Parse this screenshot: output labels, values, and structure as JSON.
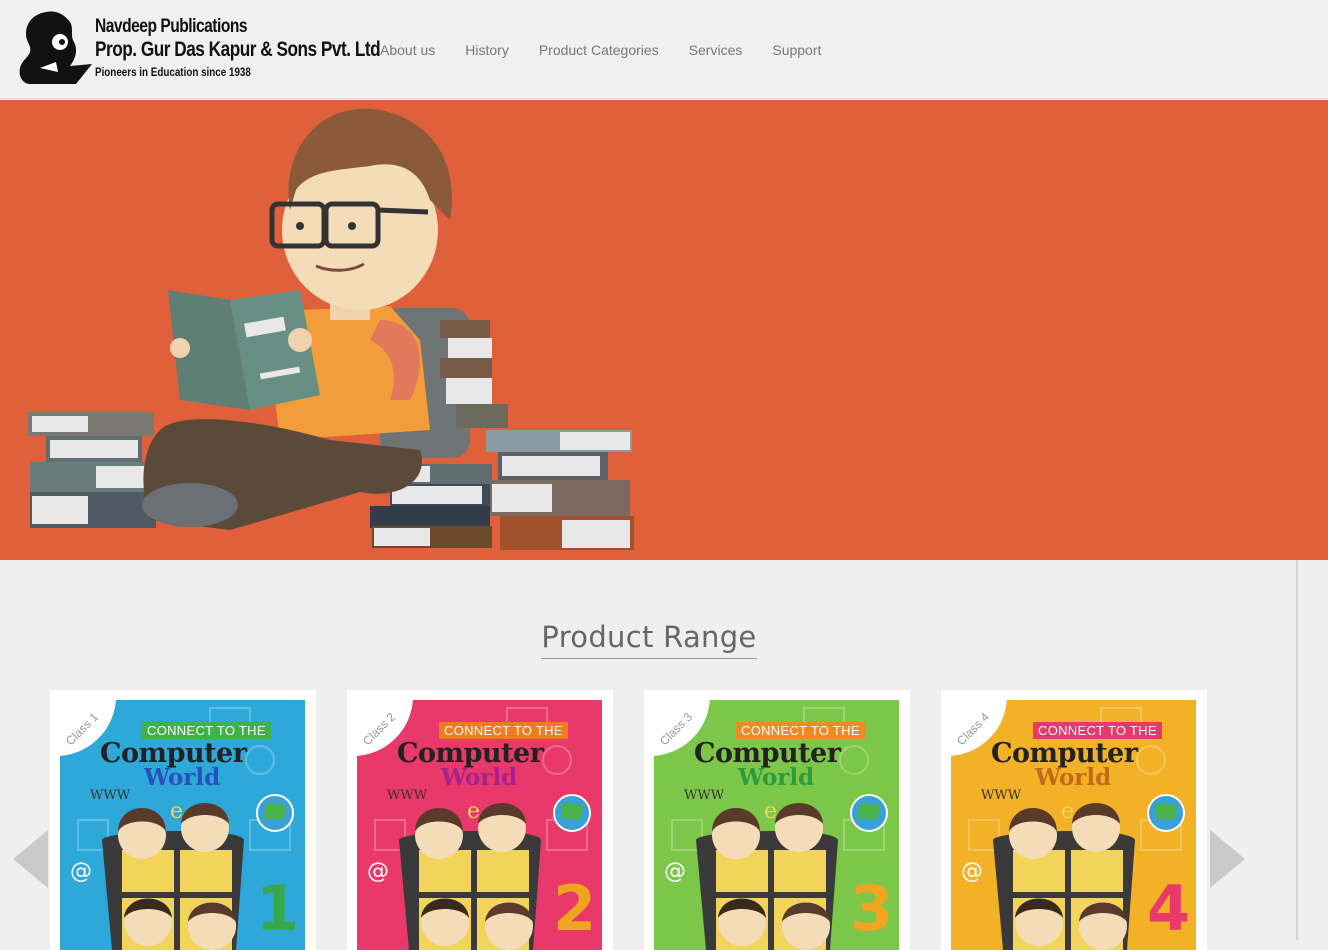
{
  "brand": {
    "line1": "Navdeep Publications",
    "line2": "Prop. Gur Das Kapur & Sons Pvt. Ltd",
    "line3": "Pioneers in Education since 1938"
  },
  "nav": {
    "items": [
      "About us",
      "History",
      "Product Categories",
      "Services",
      "Support"
    ]
  },
  "hero": {
    "background": "#e1603c"
  },
  "products": {
    "title": "Product Range",
    "cards": [
      {
        "class_label": "Class 1",
        "series_top": "CONNECT TO THE",
        "series_mid": "Computer",
        "series_bottom": "World",
        "www": "WWW",
        "number": "1",
        "bg": "#2da8d8",
        "ctt_bg": "#3fb24a",
        "world_color": "#2a4fbf",
        "num_color": "#36a84a"
      },
      {
        "class_label": "Class 2",
        "series_top": "CONNECT TO THE",
        "series_mid": "Computer",
        "series_bottom": "World",
        "www": "WWW",
        "number": "2",
        "bg": "#e8396a",
        "ctt_bg": "#f07c22",
        "world_color": "#a9208f",
        "num_color": "#f0a421"
      },
      {
        "class_label": "Class 3",
        "series_top": "CONNECT TO THE",
        "series_mid": "Computer",
        "series_bottom": "World",
        "www": "WWW",
        "number": "3",
        "bg": "#7cc64a",
        "ctt_bg": "#f08a22",
        "world_color": "#2e9b3c",
        "num_color": "#f0a421"
      },
      {
        "class_label": "Class 4",
        "series_top": "CONNECT TO THE",
        "series_mid": "Computer",
        "series_bottom": "World",
        "www": "WWW",
        "number": "4",
        "bg": "#f3b128",
        "ctt_bg": "#e8396a",
        "world_color": "#c26a15",
        "num_color": "#e8396a"
      }
    ]
  }
}
